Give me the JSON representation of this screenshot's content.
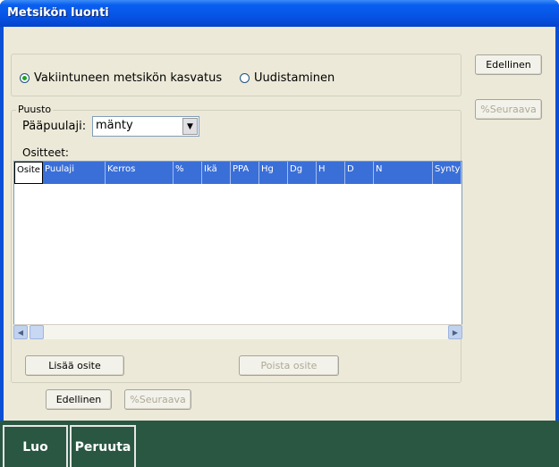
{
  "window": {
    "title": "Metsikön luonti"
  },
  "mode": {
    "option1": "Vakiintuneen metsikön kasvatus",
    "option2": "Uudistaminen",
    "selected": "option1"
  },
  "side": {
    "prev_label": "Edellinen",
    "next_label": "%Seuraava"
  },
  "puusto": {
    "legend": "Puusto",
    "paapuulaji_label": "Pääpuulaji:",
    "paapuulaji_value": "mänty",
    "ositteet_label": "Ositteet:"
  },
  "grid": {
    "columns": [
      "Osite",
      "Puulaji",
      "Kerros",
      "%",
      "Ikä",
      "PPA",
      "Hg",
      "Dg",
      "H",
      "D",
      "N",
      "Synty"
    ]
  },
  "buttons": {
    "add": "Lisää osite",
    "remove": "Poista osite",
    "prev": "Edellinen",
    "next": "%Seuraava"
  },
  "footer": {
    "create": "Luo",
    "cancel": "Peruuta"
  }
}
